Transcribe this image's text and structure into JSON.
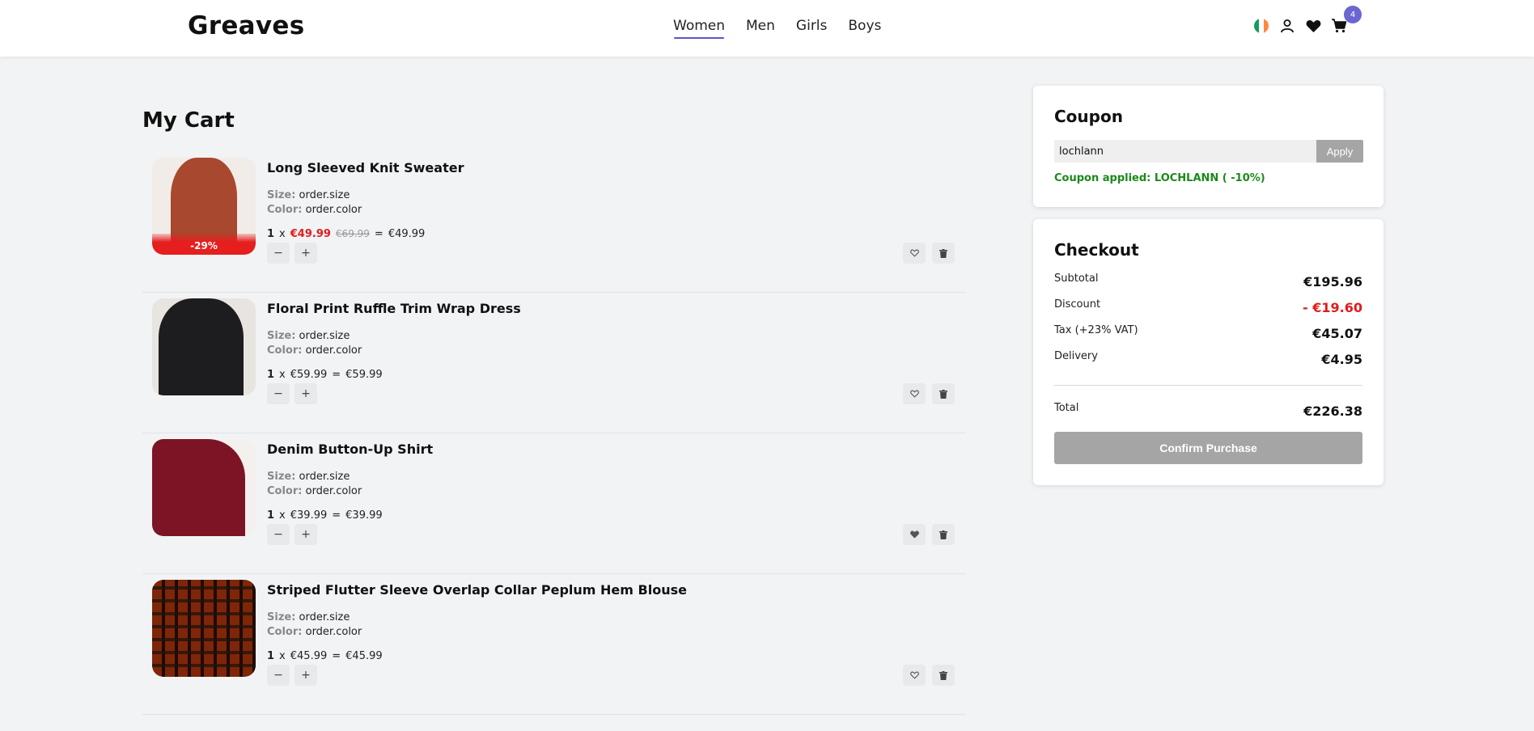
{
  "header": {
    "logo": "Greaves",
    "nav": [
      {
        "label": "Women",
        "active": true
      },
      {
        "label": "Men"
      },
      {
        "label": "Girls"
      },
      {
        "label": "Boys"
      }
    ],
    "cart_count": "4",
    "icons": [
      "ireland-flag-icon",
      "user-icon",
      "heart-icon",
      "cart-icon"
    ]
  },
  "cart": {
    "title": "My Cart",
    "size_label": "Size:",
    "color_label": "Color:",
    "items": [
      {
        "name": "Long Sleeved Knit Sweater",
        "size": "order.size",
        "color": "order.color",
        "qty": "1",
        "x": "x",
        "price": "€49.99",
        "original_price": "€69.99",
        "eq": "=",
        "line_total": "€49.99",
        "discount_badge": "-29%",
        "on_sale": true,
        "wishlisted": false,
        "image_color": "#a8482e"
      },
      {
        "name": "Floral Print Ruffle Trim Wrap Dress",
        "size": "order.size",
        "color": "order.color",
        "qty": "1",
        "x": "x",
        "price": "€59.99",
        "eq": "=",
        "line_total": "€59.99",
        "on_sale": false,
        "wishlisted": false,
        "image_color": "#1d1d1f"
      },
      {
        "name": "Denim Button-Up Shirt",
        "size": "order.size",
        "color": "order.color",
        "qty": "1",
        "x": "x",
        "price": "€39.99",
        "eq": "=",
        "line_total": "€39.99",
        "on_sale": false,
        "wishlisted": true,
        "image_color": "#7c1426"
      },
      {
        "name": "Striped Flutter Sleeve Overlap Collar Peplum Hem Blouse",
        "size": "order.size",
        "color": "order.color",
        "qty": "1",
        "x": "x",
        "price": "€45.99",
        "eq": "=",
        "line_total": "€45.99",
        "on_sale": false,
        "wishlisted": false,
        "image_color": "#b4622e"
      }
    ],
    "minus": "−",
    "plus": "+"
  },
  "coupon": {
    "title": "Coupon",
    "input_value": "lochlann",
    "apply_label": "Apply",
    "message": "Coupon applied: LOCHLANN ( -10%)"
  },
  "checkout": {
    "title": "Checkout",
    "rows": [
      {
        "label": "Subtotal",
        "value": "€195.96"
      },
      {
        "label": "Discount",
        "value": "- €19.60"
      },
      {
        "label": "Tax (+23% VAT)",
        "value": "€45.07"
      },
      {
        "label": "Delivery",
        "value": "€4.95"
      }
    ],
    "total_label": "Total",
    "total_value": "€226.38",
    "confirm_label": "Confirm Purchase"
  },
  "colors": {
    "accent": "#6b67d1",
    "sale": "#e21b1b",
    "success": "#1a8a1a",
    "disabled": "#a5a5a5"
  }
}
